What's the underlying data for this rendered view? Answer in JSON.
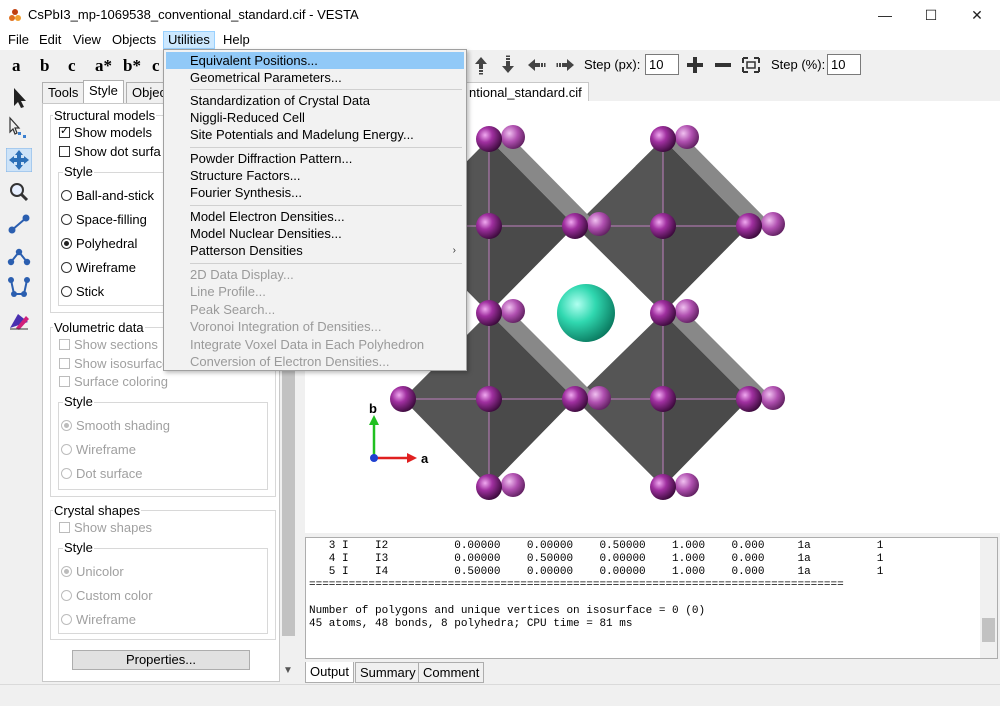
{
  "window": {
    "title": "CsPbI3_mp-1069538_conventional_standard.cif - VESTA",
    "controls": {
      "minimize": "—",
      "maximize": "☐",
      "close": "✕"
    }
  },
  "menubar": {
    "items": [
      "File",
      "Edit",
      "View",
      "Objects",
      "Utilities",
      "Help"
    ],
    "active": "Utilities"
  },
  "toolbar": {
    "axis_buttons": [
      "a",
      "b",
      "c",
      "a*",
      "b*",
      "c"
    ],
    "step_px_label": "Step (px):",
    "step_px_value": "10",
    "step_pct_label": "Step (%):",
    "step_pct_value": "10"
  },
  "left_tools": [
    "select-arrow-icon",
    "measure-icon",
    "translate-icon",
    "magnify-icon",
    "bond-length-icon",
    "bond-angle-icon",
    "dihedral-icon",
    "atom-edit-icon"
  ],
  "panel": {
    "tabs": [
      "Tools",
      "Style",
      "Objec"
    ],
    "active_tab": "Style",
    "structural": {
      "title": "Structural models",
      "show_models": "Show models",
      "show_dot_surface": "Show dot surfa",
      "style_title": "Style",
      "options": [
        "Ball-and-stick",
        "Space-filling",
        "Polyhedral",
        "Wireframe",
        "Stick"
      ],
      "selected": "Polyhedral"
    },
    "volumetric": {
      "title": "Volumetric data",
      "show_sections": "Show sections",
      "show_isosurface": "Show isosurface",
      "surface_coloring": "Surface coloring",
      "style_title": "Style",
      "options": [
        "Smooth shading",
        "Wireframe",
        "Dot surface"
      ],
      "selected": "Smooth shading"
    },
    "crystal_shapes": {
      "title": "Crystal shapes",
      "show_shapes": "Show shapes",
      "style_title": "Style",
      "options": [
        "Unicolor",
        "Custom color",
        "Wireframe"
      ],
      "selected": "Unicolor"
    },
    "properties_button": "Properties..."
  },
  "viewer": {
    "file_tab": "ntional_standard.cif",
    "axis_labels": {
      "b": "b",
      "a": "a"
    },
    "colors": {
      "iodine": "#8e1f8e",
      "cesium": "#2fd3b0",
      "polyhedra": "#4a4a4a"
    }
  },
  "output": {
    "lines": [
      "   3 I    I2          0.00000    0.00000    0.50000    1.000    0.000     1a          1",
      "   4 I    I3          0.00000    0.50000    0.00000    1.000    0.000     1a          1",
      "   5 I    I4          0.50000    0.00000    0.00000    1.000    0.000     1a          1",
      "=================================================================================",
      "",
      "Number of polygons and unique vertices on isosurface = 0 (0)",
      "45 atoms, 48 bonds, 8 polyhedra; CPU time = 81 ms"
    ],
    "tabs": [
      "Output",
      "Summary",
      "Comment"
    ],
    "active_tab": "Output"
  },
  "utilities_menu": {
    "items": [
      {
        "label": "Equivalent Positions...",
        "enabled": true,
        "highlighted": true
      },
      {
        "label": "Geometrical Parameters...",
        "enabled": true
      },
      {
        "label": "Standardization of Crystal Data",
        "enabled": true
      },
      {
        "label": "Niggli-Reduced Cell",
        "enabled": true
      },
      {
        "label": "Site Potentials and Madelung Energy...",
        "enabled": true
      },
      {
        "label": "Powder Diffraction Pattern...",
        "enabled": true
      },
      {
        "label": "Structure Factors...",
        "enabled": true
      },
      {
        "label": "Fourier Synthesis...",
        "enabled": true
      },
      {
        "label": "Model Electron Densities...",
        "enabled": true
      },
      {
        "label": "Model Nuclear Densities...",
        "enabled": true
      },
      {
        "label": "Patterson Densities",
        "enabled": true,
        "submenu": "›"
      },
      {
        "label": "2D Data Display...",
        "enabled": false
      },
      {
        "label": "Line Profile...",
        "enabled": false
      },
      {
        "label": "Peak Search...",
        "enabled": false
      },
      {
        "label": "Voronoi Integration of Densities...",
        "enabled": false
      },
      {
        "label": "Integrate Voxel Data in Each Polyhedron",
        "enabled": false
      },
      {
        "label": "Conversion of Electron Densities...",
        "enabled": false
      }
    ]
  }
}
